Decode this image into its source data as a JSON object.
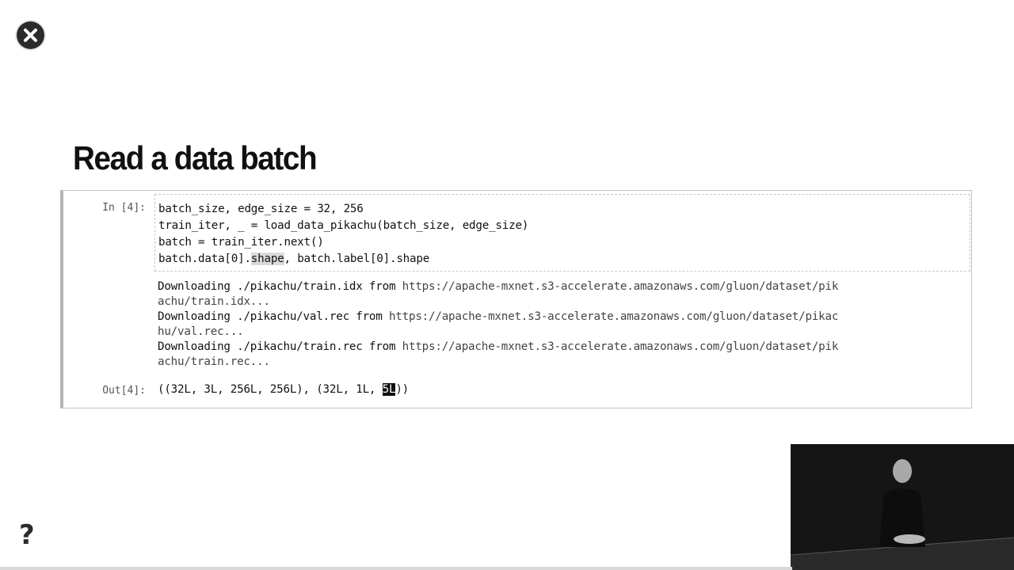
{
  "slide": {
    "title": "Read a data batch"
  },
  "notebook": {
    "in_prompt": "In [4]:",
    "out_prompt": "Out[4]:",
    "code": {
      "line1": "batch_size, edge_size = 32, 256",
      "line2": "train_iter, _ = load_data_pikachu(batch_size, edge_size)",
      "line3": "batch = train_iter.next()",
      "line4_pre": "batch.data[0].",
      "line4_hl": "shape",
      "line4_post": ", batch.label[0].shape"
    },
    "stream": [
      {
        "prefix": "Downloading ./pikachu/train.idx from ",
        "url1": "https://apache-mxnet.s3-accelerate.amazonaws.com/gluon/dataset/pik",
        "url2": "achu/train.idx..."
      },
      {
        "prefix": "Downloading ./pikachu/val.rec from ",
        "url1": "https://apache-mxnet.s3-accelerate.amazonaws.com/gluon/dataset/pikac",
        "url2": "hu/val.rec..."
      },
      {
        "prefix": "Downloading ./pikachu/train.rec from ",
        "url1": "https://apache-mxnet.s3-accelerate.amazonaws.com/gluon/dataset/pik",
        "url2": "achu/train.rec..."
      }
    ],
    "output": {
      "pre": "((32L, 3L, 256L, 256L), (32L, 1L, ",
      "sel": "5L",
      "post": "))"
    }
  },
  "controls": {
    "close_icon": "close-circle-icon",
    "help_label": "?"
  }
}
